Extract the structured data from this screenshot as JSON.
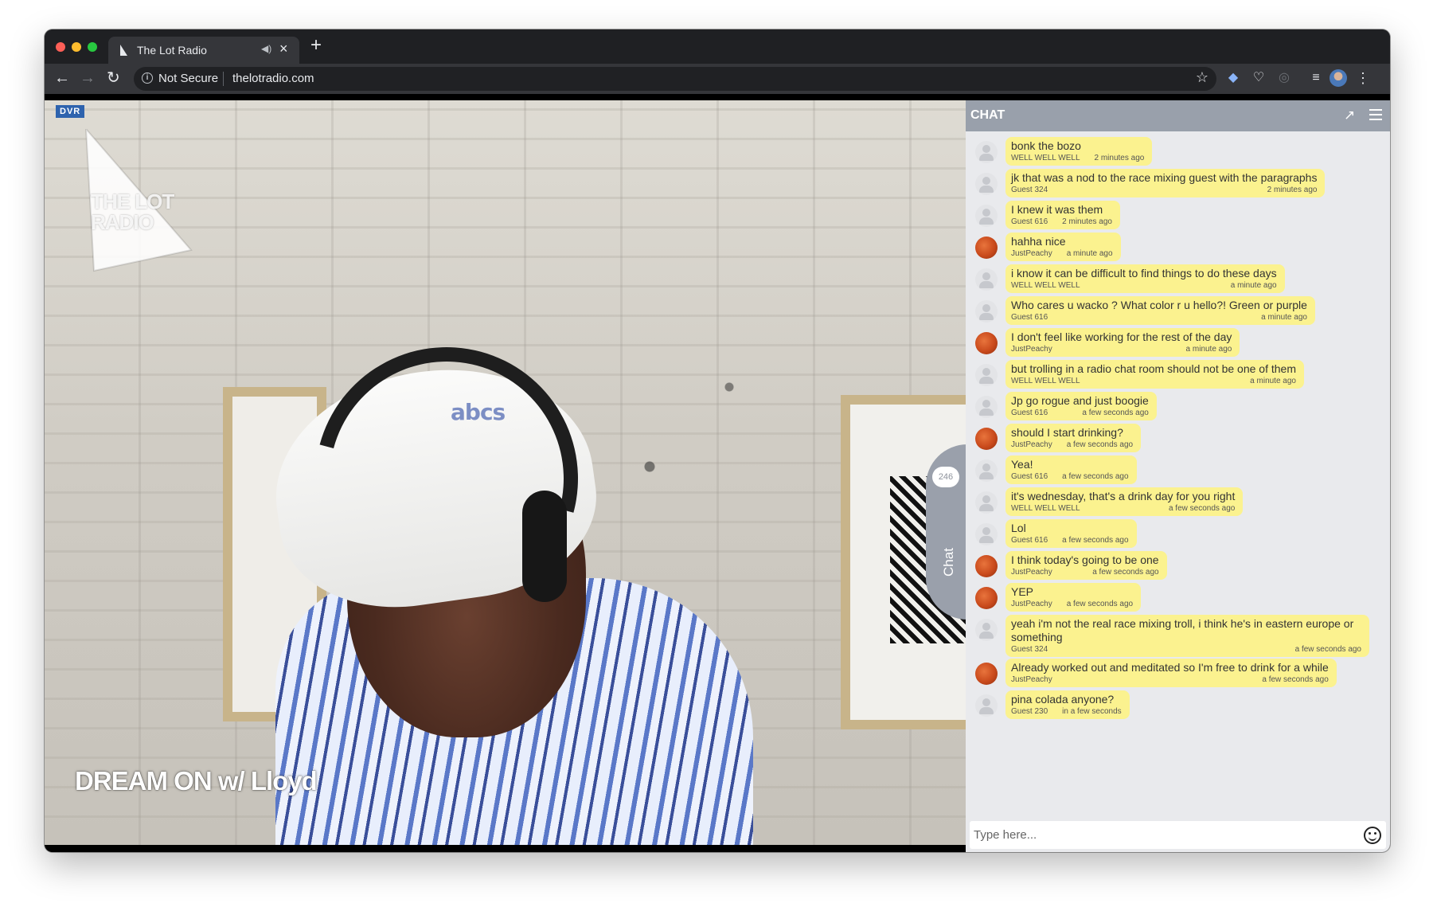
{
  "browser": {
    "tab": {
      "title": "The Lot Radio",
      "mute_icon": "speaker-icon",
      "close_glyph": "×"
    },
    "new_tab_glyph": "+",
    "nav": {
      "back": "←",
      "forward": "→",
      "reload": "↻"
    },
    "address": {
      "security_label": "Not Secure",
      "url": "thelotradio.com"
    },
    "star_glyph": "☆",
    "menu_glyph": "⋮"
  },
  "video": {
    "dvr_badge": "DVR",
    "logo_text": "THE LOT RADIO",
    "show_title": "DREAM ON w/ Lloyd",
    "cap_logo": "abcs"
  },
  "chat_tab": {
    "count": "246",
    "label": "Chat"
  },
  "chat": {
    "title": "CHAT",
    "input_placeholder": "Type here...",
    "messages": [
      {
        "text": "bonk the bozo",
        "author": "WELL WELL WELL",
        "time": "2 minutes ago",
        "avatar": "guest"
      },
      {
        "text": "jk that was a nod to the race mixing guest with the paragraphs",
        "author": "Guest 324",
        "time": "2 minutes ago",
        "avatar": "guest"
      },
      {
        "text": "I knew it was them",
        "author": "Guest 616",
        "time": "2 minutes ago",
        "avatar": "guest"
      },
      {
        "text": "hahha nice",
        "author": "JustPeachy",
        "time": "a minute ago",
        "avatar": "peachy"
      },
      {
        "text": "i know it can be difficult to find things to do these days",
        "author": "WELL WELL WELL",
        "time": "a minute ago",
        "avatar": "guest"
      },
      {
        "text": "Who cares u wacko ? What color r u hello?! Green or purple",
        "author": "Guest 616",
        "time": "a minute ago",
        "avatar": "guest"
      },
      {
        "text": "I don't feel like working for the rest of the day",
        "author": "JustPeachy",
        "time": "a minute ago",
        "avatar": "peachy"
      },
      {
        "text": "but trolling in a radio chat room should not be one of them",
        "author": "WELL WELL WELL",
        "time": "a minute ago",
        "avatar": "guest"
      },
      {
        "text": "Jp go rogue and just boogie",
        "author": "Guest 616",
        "time": "a few seconds ago",
        "avatar": "guest"
      },
      {
        "text": "should I start drinking?",
        "author": "JustPeachy",
        "time": "a few seconds ago",
        "avatar": "peachy"
      },
      {
        "text": "Yea!",
        "author": "Guest 616",
        "time": "a few seconds ago",
        "avatar": "guest"
      },
      {
        "text": "it's wednesday, that's a drink day for you right",
        "author": "WELL WELL WELL",
        "time": "a few seconds ago",
        "avatar": "guest"
      },
      {
        "text": "Lol",
        "author": "Guest 616",
        "time": "a few seconds ago",
        "avatar": "guest"
      },
      {
        "text": "I think today's going to be one",
        "author": "JustPeachy",
        "time": "a few seconds ago",
        "avatar": "peachy"
      },
      {
        "text": "YEP",
        "author": "JustPeachy",
        "time": "a few seconds ago",
        "avatar": "peachy"
      },
      {
        "text": "yeah i'm not the real race mixing troll, i think he's in eastern europe or something",
        "author": "Guest 324",
        "time": "a few seconds ago",
        "avatar": "guest"
      },
      {
        "text": "Already worked out and meditated so I'm free to drink for a while",
        "author": "JustPeachy",
        "time": "a few seconds ago",
        "avatar": "peachy"
      },
      {
        "text": "pina colada anyone?",
        "author": "Guest 230",
        "time": "in a few seconds",
        "avatar": "guest"
      }
    ]
  }
}
